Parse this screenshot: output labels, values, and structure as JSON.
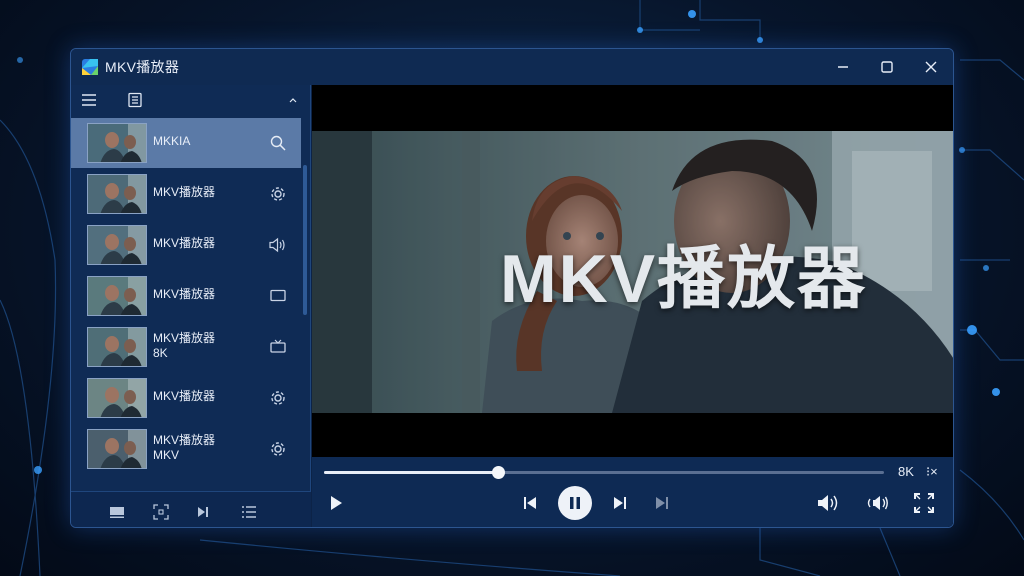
{
  "window": {
    "title": "MKV播放器"
  },
  "sidebar": {
    "items": [
      {
        "label": "MKKIA",
        "sub": "",
        "icon": "search-icon",
        "selected": true
      },
      {
        "label": "MKV播放器",
        "sub": "",
        "icon": "gear-icon",
        "selected": false
      },
      {
        "label": "MKV播放器",
        "sub": "",
        "icon": "speaker-icon",
        "selected": false
      },
      {
        "label": "MKV播放器",
        "sub": "",
        "icon": "screen-icon",
        "selected": false
      },
      {
        "label": "MKV播放器",
        "sub": "8K",
        "icon": "tv-icon",
        "selected": false
      },
      {
        "label": "MKV播放器",
        "sub": "",
        "icon": "gear-icon",
        "selected": false
      },
      {
        "label": "MKV播放器",
        "sub": "MKV",
        "icon": "gear-icon",
        "selected": false
      }
    ]
  },
  "video": {
    "overlay_title": "MKV播放器"
  },
  "playback": {
    "progress_fraction": 0.31,
    "quality_label": "8K",
    "speed_label": "⁝×"
  },
  "colors": {
    "accent": "#2c5590",
    "window_bg": "#0c2347",
    "selected_row": "#5b7aa7"
  }
}
